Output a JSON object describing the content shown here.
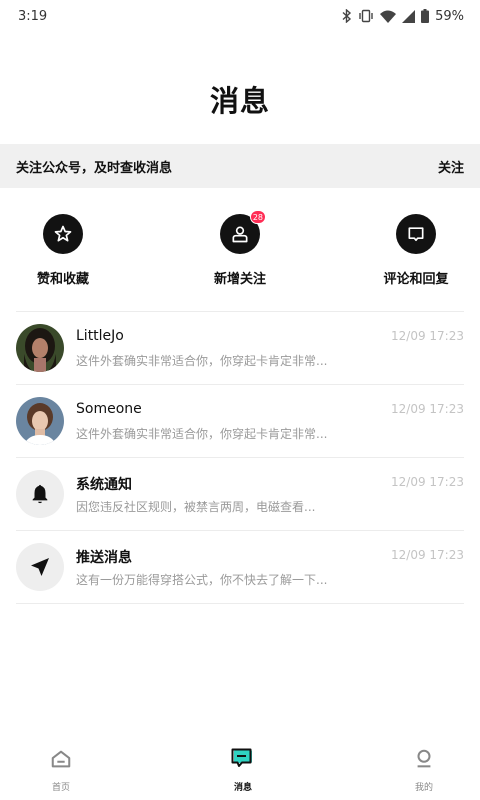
{
  "status_bar": {
    "time": "3:19",
    "battery": "59%",
    "icons": [
      "bluetooth-icon",
      "vibrate-icon",
      "wifi-icon",
      "signal-icon",
      "battery-icon"
    ]
  },
  "page": {
    "title": "消息"
  },
  "banner": {
    "text": "关注公众号，及时查收消息",
    "action": "关注"
  },
  "quick_actions": [
    {
      "label": "赞和收藏",
      "icon": "star-icon",
      "badge": ""
    },
    {
      "label": "新增关注",
      "icon": "user-icon",
      "badge": "28"
    },
    {
      "label": "评论和回复",
      "icon": "comment-icon",
      "badge": ""
    }
  ],
  "messages": [
    {
      "name": "LittleJo",
      "preview": "这件外套确实非常适合你，你穿起卡肯定非常...",
      "time": "12/09 17:23",
      "avatar": "photo"
    },
    {
      "name": "Someone",
      "preview": "这件外套确实非常适合你，你穿起卡肯定非常...",
      "time": "12/09 17:23",
      "avatar": "photo"
    },
    {
      "name": "系统通知",
      "preview": "因您违反社区规则，被禁言两周，电磁查看...",
      "time": "12/09 17:23",
      "avatar": "bell-icon"
    },
    {
      "name": "推送消息",
      "preview": "这有一份万能得穿搭公式，你不快去了解一下...",
      "time": "12/09 17:23",
      "avatar": "send-icon"
    }
  ],
  "bottom_nav": [
    {
      "label": "首页",
      "icon": "home-icon",
      "active": false
    },
    {
      "label": "消息",
      "icon": "message-icon",
      "active": true
    },
    {
      "label": "我的",
      "icon": "profile-icon",
      "active": false
    }
  ],
  "colors": {
    "accent": "#2fd3c2",
    "badge": "#ff2d55",
    "banner_bg": "#f0f0f0"
  }
}
